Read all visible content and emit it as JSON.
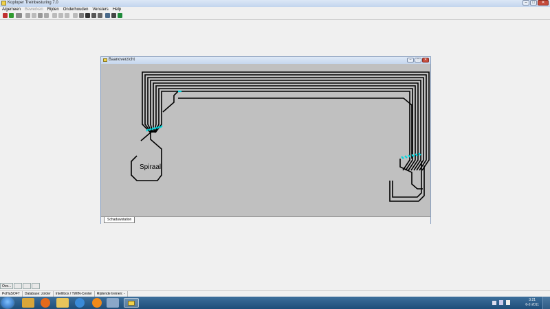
{
  "app": {
    "title": "Koploper Treinbesturing 7.0"
  },
  "window_controls": {
    "minimize": "–",
    "maximize": "□",
    "close": "✕"
  },
  "menu": [
    "Algemeen",
    "Bewerken",
    "Rijden",
    "Onderhouden",
    "Vensters",
    "Help"
  ],
  "menu_disabled": [
    "Bewerken"
  ],
  "child_window": {
    "title": "Baanoverzicht",
    "label": "Spiraal",
    "tab": "Schaduwstation",
    "track_color": "#000000",
    "highlight_color": "#00d8e0",
    "background": "#c0c0c0"
  },
  "mdi_tabs": [
    "Ove...",
    "",
    "",
    ""
  ],
  "statusbar": [
    "PoHaSOFT",
    "Database: zolder",
    "Intellibox / TWIN-Center",
    "Rijdende treinen: -"
  ],
  "taskbar": {
    "apps": [
      "windows-explorer",
      "firefox",
      "folder",
      "internet-explorer",
      "media-player",
      "network",
      "koploper"
    ],
    "clock_time": "3:21",
    "clock_date": "6-2-2011"
  },
  "colors": {
    "accent_taskbar": "#2a5a88",
    "window_bg": "#f0f0f0"
  }
}
